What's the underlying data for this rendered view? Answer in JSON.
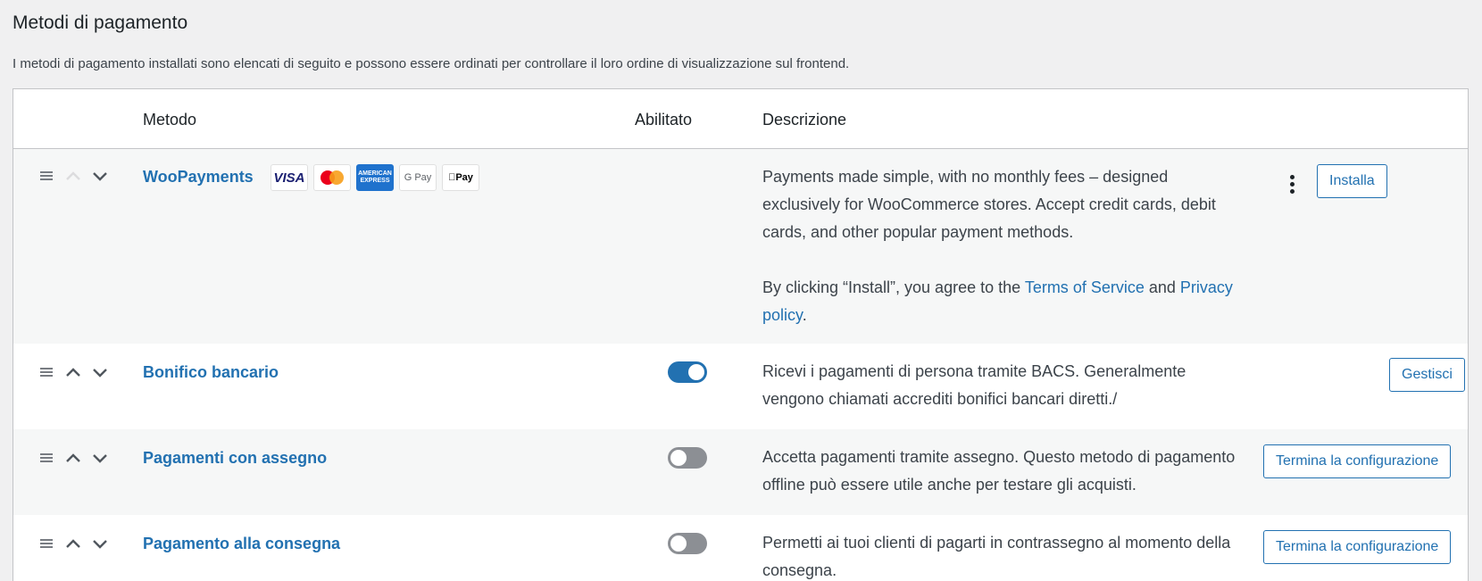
{
  "page": {
    "title": "Metodi di pagamento",
    "intro": "I metodi di pagamento installati sono elencati di seguito e possono essere ordinati per controllare il loro ordine di visualizzazione sul frontend."
  },
  "table": {
    "headers": {
      "method": "Metodo",
      "enabled": "Abilitato",
      "description": "Descrizione"
    }
  },
  "rows": [
    {
      "name": "WooPayments",
      "cards": {
        "visa": "VISA",
        "mastercard": "mastercard",
        "amex": "AMERICAN EXPRESS",
        "gpay": "G Pay",
        "applepay": "Pay"
      },
      "description": "Payments made simple, with no monthly fees – designed exclusively for WooCommerce stores. Accept credit cards, debit cards, and other popular payment methods.",
      "terms_prefix": "By clicking “Install”, you agree to the ",
      "terms_link": "Terms of Service",
      "terms_and": " and ",
      "privacy_link": "Privacy policy",
      "terms_suffix": ".",
      "button": "Installa"
    },
    {
      "name": "Bonifico bancario",
      "enabled": true,
      "description": "Ricevi i pagamenti di persona tramite BACS. Generalmente vengono chiamati accrediti bonifici bancari diretti./",
      "button": "Gestisci"
    },
    {
      "name": "Pagamenti con assegno",
      "enabled": false,
      "description": "Accetta pagamenti tramite assegno. Questo metodo di pagamento offline può essere utile anche per testare gli acquisti.",
      "button": "Termina la configurazione"
    },
    {
      "name": "Pagamento alla consegna",
      "enabled": false,
      "description": "Permetti ai tuoi clienti di pagarti in contrassegno al momento della consegna.",
      "button": "Termina la configurazione"
    }
  ],
  "colors": {
    "accent": "#2271b1",
    "toggle_off": "#8c8f94",
    "background": "#f0f0f1"
  }
}
